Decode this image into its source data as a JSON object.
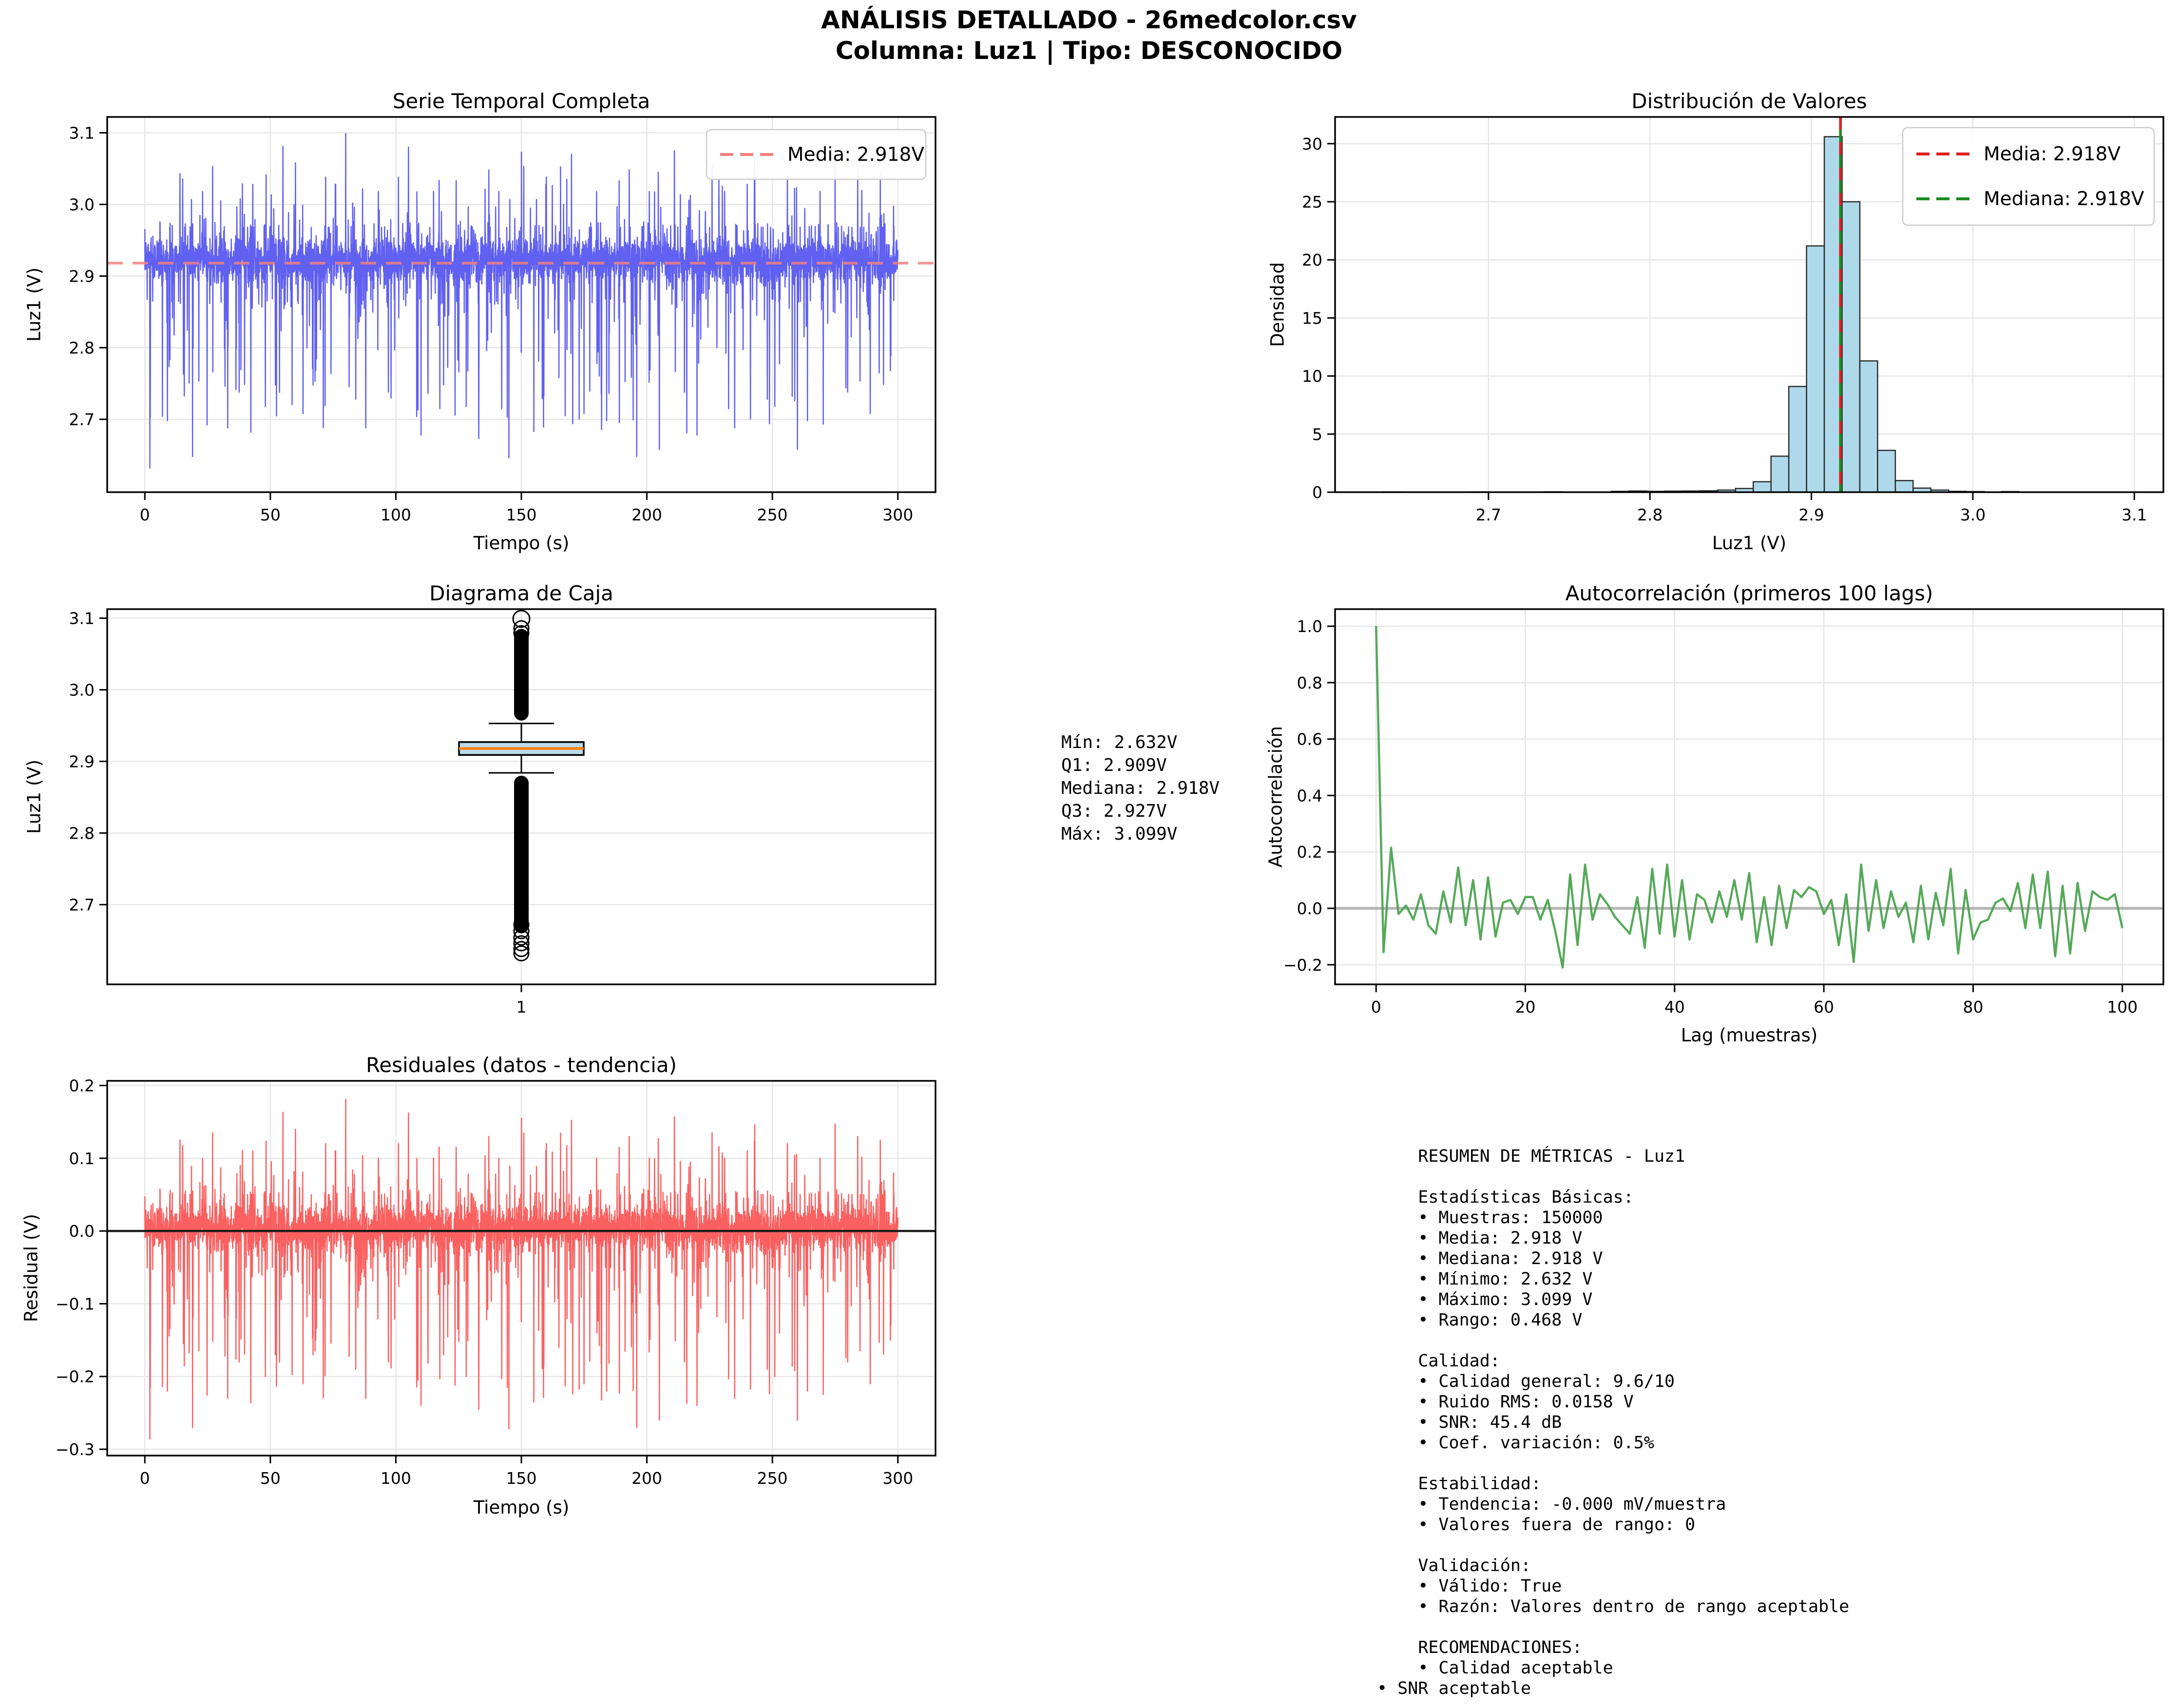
{
  "suptitle": {
    "line1": "ANÁLISIS DETALLADO - 26medcolor.csv",
    "line2": "Columna: Luz1 | Tipo: DESCONOCIDO"
  },
  "colors": {
    "series_blue": "#4444ee",
    "mean_salmon": "#f08080",
    "hist_fill": "#aed9ea",
    "hist_edge": "#2b2b2b",
    "mean_red": "#e01f1f",
    "median_green": "#1f8b1f",
    "box_fill": "#b9dcea",
    "box_median_orange": "#ff7f0e",
    "acf_green": "#44a048",
    "resid_red": "#f94f4f",
    "grid_gray": "#e6e6e6",
    "zero_gray": "#888888",
    "zero_black": "#1a1a1a",
    "frame_black": "#000000",
    "legend_border": "#cccccc"
  },
  "chart_data": [
    {
      "id": "serie",
      "type": "line_noise",
      "title": "Serie Temporal Completa",
      "xlabel": "Tiempo (s)",
      "ylabel": "Luz1 (V)",
      "xticks": {
        "values": [
          0,
          50,
          100,
          150,
          200,
          250,
          300
        ],
        "labels": [
          "0",
          "50",
          "100",
          "150",
          "200",
          "250",
          "300"
        ]
      },
      "yticks": {
        "values": [
          2.7,
          2.8,
          2.9,
          3.0,
          3.1
        ],
        "labels": [
          "2.7",
          "2.8",
          "2.9",
          "3.0",
          "3.1"
        ]
      },
      "xlim": [
        -15,
        315
      ],
      "ylim": [
        2.5983,
        3.1221
      ],
      "grid": true,
      "legend": [
        {
          "label": "Media: 2.918V",
          "color": "#f08080"
        }
      ],
      "mean": 2.918,
      "series_stats": {
        "n_samples": 150000,
        "duration_s": 300,
        "mean_V": 2.918,
        "min_V": 2.632,
        "max_V": 3.099
      },
      "noise_model": {
        "seed": 7,
        "n_points": 4200,
        "duration_s": 300,
        "noise_std": 0.0158,
        "clip_lo": -0.042,
        "clip_hi": 0.057,
        "p_down": 0.055,
        "down_max": 0.24,
        "p_up": 0.04,
        "up_max": 0.135,
        "forced": [
          [
            2,
            -0.286
          ],
          [
            9,
            -0.22
          ],
          [
            14,
            0.125
          ],
          [
            19,
            -0.27
          ],
          [
            23,
            0.1
          ],
          [
            27,
            0.135
          ],
          [
            33,
            -0.23
          ],
          [
            38,
            0.09
          ],
          [
            43,
            0.11
          ],
          [
            48,
            -0.2
          ],
          [
            52,
            -0.17
          ],
          [
            55,
            0.163
          ],
          [
            60,
            0.14
          ],
          [
            63,
            -0.21
          ],
          [
            67,
            -0.17
          ],
          [
            72,
            0.12
          ],
          [
            76,
            0.11
          ],
          [
            80,
            0.181
          ],
          [
            84,
            -0.19
          ],
          [
            88,
            -0.23
          ],
          [
            93,
            0.1
          ],
          [
            97,
            -0.18
          ],
          [
            101,
            0.12
          ],
          [
            105,
            0.162
          ],
          [
            110,
            -0.24
          ],
          [
            115,
            0.1
          ],
          [
            119,
            -0.17
          ],
          [
            124,
            0.115
          ],
          [
            128,
            -0.2
          ],
          [
            133,
            -0.245
          ],
          [
            137,
            0.13
          ],
          [
            141,
            0.1
          ],
          [
            145,
            -0.272
          ],
          [
            150,
            0.155
          ],
          [
            155,
            -0.235
          ],
          [
            160,
            0.12
          ],
          [
            165,
            -0.16
          ],
          [
            170,
            0.152
          ],
          [
            175,
            -0.21
          ],
          [
            180,
            0.1
          ],
          [
            184,
            -0.22
          ],
          [
            189,
            0.115
          ],
          [
            193,
            0.13
          ],
          [
            196,
            -0.27
          ],
          [
            201,
            0.1
          ],
          [
            205,
            -0.26
          ],
          [
            211,
            0.157
          ],
          [
            215,
            -0.18
          ],
          [
            220,
            -0.24
          ],
          [
            226,
            0.135
          ],
          [
            231,
            0.1
          ],
          [
            235,
            -0.23
          ],
          [
            240,
            0.11
          ],
          [
            243,
            0.146
          ],
          [
            248,
            -0.19
          ],
          [
            251,
            -0.2
          ],
          [
            256,
            0.12
          ],
          [
            260,
            -0.26
          ],
          [
            264,
            -0.22
          ],
          [
            269,
            0.1
          ],
          [
            275,
            0.147
          ],
          [
            280,
            -0.18
          ],
          [
            284,
            0.13
          ],
          [
            289,
            -0.21
          ],
          [
            293,
            0.125
          ],
          [
            297,
            -0.15
          ]
        ]
      }
    },
    {
      "id": "hist",
      "type": "histogram",
      "title": "Distribución de Valores",
      "xlabel": "Luz1 (V)",
      "ylabel": "Densidad",
      "xticks": {
        "values": [
          2.7,
          2.8,
          2.9,
          3.0,
          3.1
        ],
        "labels": [
          "2.7",
          "2.8",
          "2.9",
          "3.0",
          "3.1"
        ]
      },
      "yticks": {
        "values": [
          0,
          5,
          10,
          15,
          20,
          25,
          30
        ],
        "labels": [
          "0",
          "5",
          "10",
          "15",
          "20",
          "25",
          "30"
        ]
      },
      "xlim": [
        2.605,
        3.118
      ],
      "ylim": [
        0,
        32.3
      ],
      "grid": true,
      "bin_width": 0.011,
      "bars": [
        [
          2.64,
          0.02
        ],
        [
          2.695,
          0.02
        ],
        [
          2.74,
          0.03
        ],
        [
          2.7815,
          0.07
        ],
        [
          2.7925,
          0.1
        ],
        [
          2.8035,
          0.07
        ],
        [
          2.8145,
          0.09
        ],
        [
          2.8255,
          0.1
        ],
        [
          2.8365,
          0.12
        ],
        [
          2.8475,
          0.18
        ],
        [
          2.8585,
          0.32
        ],
        [
          2.8695,
          0.9
        ],
        [
          2.8805,
          3.1
        ],
        [
          2.8915,
          9.1
        ],
        [
          2.9025,
          21.2
        ],
        [
          2.9135,
          30.6
        ],
        [
          2.9245,
          25.0
        ],
        [
          2.9355,
          11.3
        ],
        [
          2.9465,
          3.6
        ],
        [
          2.9575,
          1.0
        ],
        [
          2.9685,
          0.35
        ],
        [
          2.9795,
          0.18
        ],
        [
          2.9905,
          0.07
        ],
        [
          3.0015,
          0.05
        ],
        [
          3.023,
          0.05
        ]
      ],
      "mean": 2.918,
      "median": 2.918,
      "legend": [
        {
          "label": "Media: 2.918V",
          "color": "#e01f1f"
        },
        {
          "label": "Mediana: 2.918V",
          "color": "#1f8b1f"
        }
      ]
    },
    {
      "id": "box",
      "type": "boxplot",
      "title": "Diagrama de Caja",
      "ylabel": "Luz1 (V)",
      "xticks": {
        "values": [
          1
        ],
        "labels": [
          "1"
        ]
      },
      "yticks": {
        "values": [
          2.7,
          2.8,
          2.9,
          3.0,
          3.1
        ],
        "labels": [
          "2.7",
          "2.8",
          "2.9",
          "3.0",
          "3.1"
        ]
      },
      "xlim": [
        0.5,
        1.5
      ],
      "ylim": [
        2.5887,
        3.1126
      ],
      "grid": true,
      "stats": {
        "min": 2.632,
        "q1": 2.909,
        "median": 2.918,
        "q3": 2.927,
        "max": 3.099,
        "whisker_low": 2.884,
        "whisker_high": 2.953
      },
      "outliers": {
        "dense_high": [
          2.957,
          3.085
        ],
        "dense_low": [
          2.66,
          2.88
        ],
        "circles_high": [
          3.099,
          3.086,
          3.079
        ],
        "circles_low": [
          2.632,
          2.638,
          2.646,
          2.654,
          2.663,
          2.672
        ]
      },
      "annotation": "Mín: 2.632V\nQ1: 2.909V\nMediana: 2.918V\nQ3: 2.927V\nMáx: 3.099V"
    },
    {
      "id": "acf",
      "type": "line",
      "title": "Autocorrelación (primeros 100 lags)",
      "xlabel": "Lag (muestras)",
      "ylabel": "Autocorrelación",
      "xticks": {
        "values": [
          0,
          20,
          40,
          60,
          80,
          100
        ],
        "labels": [
          "0",
          "20",
          "40",
          "60",
          "80",
          "100"
        ]
      },
      "yticks": {
        "values": [
          -0.2,
          0.0,
          0.2,
          0.4,
          0.6,
          0.8,
          1.0
        ],
        "labels": [
          "−0.2",
          "0.0",
          "0.2",
          "0.4",
          "0.6",
          "0.8",
          "1.0"
        ]
      },
      "xlim": [
        -5.5,
        105.5
      ],
      "ylim": [
        -0.2694,
        1.0605
      ],
      "grid": true,
      "zero_line": true,
      "x_start": 0,
      "values": [
        1.0,
        -0.155,
        0.215,
        -0.02,
        0.01,
        -0.04,
        0.05,
        -0.06,
        -0.09,
        0.06,
        -0.05,
        0.145,
        -0.06,
        0.1,
        -0.11,
        0.11,
        -0.1,
        0.02,
        0.03,
        -0.02,
        0.04,
        0.04,
        -0.04,
        0.03,
        -0.08,
        -0.21,
        0.12,
        -0.13,
        0.155,
        -0.04,
        0.05,
        0.015,
        -0.03,
        -0.06,
        -0.09,
        0.04,
        -0.14,
        0.14,
        -0.09,
        0.155,
        -0.1,
        0.1,
        -0.11,
        0.05,
        0.03,
        -0.05,
        0.06,
        -0.03,
        0.1,
        -0.04,
        0.125,
        -0.12,
        0.04,
        -0.13,
        0.08,
        -0.07,
        0.065,
        0.04,
        0.075,
        0.06,
        -0.02,
        0.03,
        -0.13,
        0.05,
        -0.19,
        0.155,
        -0.08,
        0.1,
        -0.07,
        0.06,
        -0.03,
        0.02,
        -0.12,
        0.08,
        -0.11,
        0.055,
        -0.06,
        0.14,
        -0.16,
        0.065,
        -0.11,
        -0.05,
        -0.04,
        0.02,
        0.035,
        -0.01,
        0.09,
        -0.07,
        0.12,
        -0.07,
        0.13,
        -0.17,
        0.08,
        -0.16,
        0.09,
        -0.08,
        0.06,
        0.04,
        0.03,
        0.05,
        -0.07
      ]
    },
    {
      "id": "resid",
      "type": "line_noise",
      "title": "Residuales (datos - tendencia)",
      "xlabel": "Tiempo (s)",
      "ylabel": "Residual (V)",
      "xticks": {
        "values": [
          0,
          50,
          100,
          150,
          200,
          250,
          300
        ],
        "labels": [
          "0",
          "50",
          "100",
          "150",
          "200",
          "250",
          "300"
        ]
      },
      "yticks": {
        "values": [
          -0.3,
          -0.2,
          -0.1,
          0.0,
          0.1,
          0.2
        ],
        "labels": [
          "−0.3",
          "−0.2",
          "−0.1",
          "0.0",
          "0.1",
          "0.2"
        ]
      },
      "xlim": [
        -15,
        315
      ],
      "ylim": [
        -0.3087,
        0.2064
      ],
      "grid": true,
      "zero_line": true,
      "mean": 0,
      "uses_series_noise": true,
      "series_stats": {
        "min_V": -0.286,
        "max_V": 0.182,
        "rms_V": 0.0158
      }
    }
  ],
  "summary": {
    "text": "    RESUMEN DE MÉTRICAS - Luz1\n\n    Estadísticas Básicas:\n    • Muestras: 150000\n    • Media: 2.918 V\n    • Mediana: 2.918 V\n    • Mínimo: 2.632 V\n    • Máximo: 3.099 V\n    • Rango: 0.468 V\n\n    Calidad:\n    • Calidad general: 9.6/10\n    • Ruido RMS: 0.0158 V\n    • SNR: 45.4 dB\n    • Coef. variación: 0.5%\n\n    Estabilidad:\n    • Tendencia: -0.000 mV/muestra\n    • Valores fuera de rango: 0\n\n    Validación:\n    • Válido: True\n    • Razón: Valores dentro de rango aceptable\n\n    RECOMENDACIONES:\n    • Calidad aceptable\n• SNR aceptable"
  }
}
